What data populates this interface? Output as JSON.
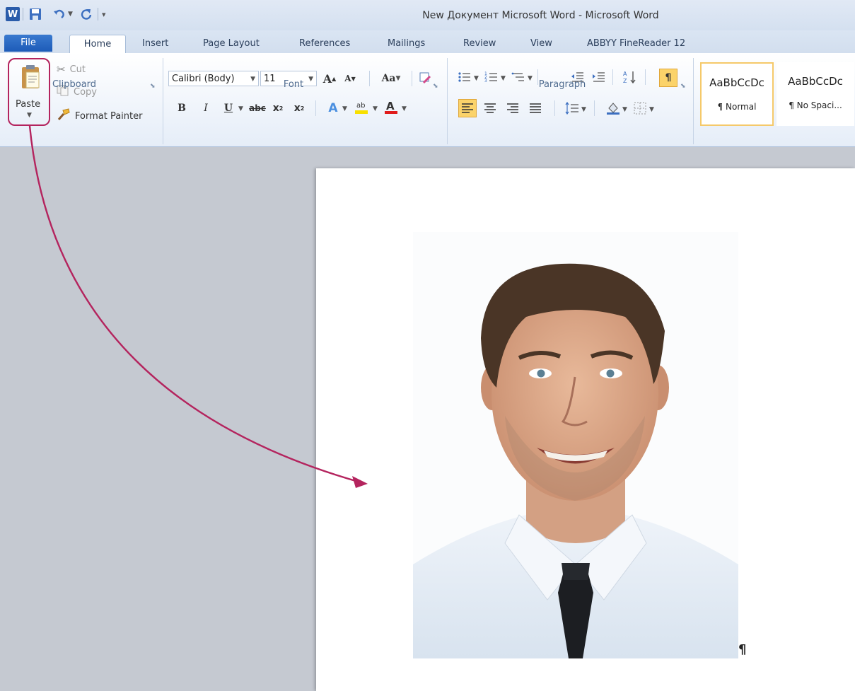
{
  "window": {
    "title": "New Документ Microsoft Word - Microsoft Word",
    "app_icon": "W"
  },
  "quick_access": [
    {
      "name": "save-icon"
    },
    {
      "name": "undo-icon"
    },
    {
      "name": "redo-icon"
    },
    {
      "name": "customize-icon"
    }
  ],
  "tabs": [
    "File",
    "Home",
    "Insert",
    "Page Layout",
    "References",
    "Mailings",
    "Review",
    "View",
    "ABBYY FineReader 12"
  ],
  "clipboard": {
    "paste_label": "Paste",
    "cut_label": "Cut",
    "copy_label": "Copy",
    "format_painter_label": "Format Painter",
    "group_label": "Clipboard"
  },
  "font": {
    "family": "Calibri (Body)",
    "size": "11",
    "group_label": "Font"
  },
  "paragraph": {
    "group_label": "Paragraph"
  },
  "styles": [
    {
      "sample": "AaBbCcDc",
      "name": "¶ Normal",
      "selected": true
    },
    {
      "sample": "AaBbCcDc",
      "name": "¶ No Spaci...",
      "selected": false
    }
  ],
  "document": {
    "paragraph_mark": "¶"
  },
  "colors": {
    "accent": "#b4245e",
    "file_tab": "#2a66c3",
    "selected_style": "#f5c96a"
  }
}
